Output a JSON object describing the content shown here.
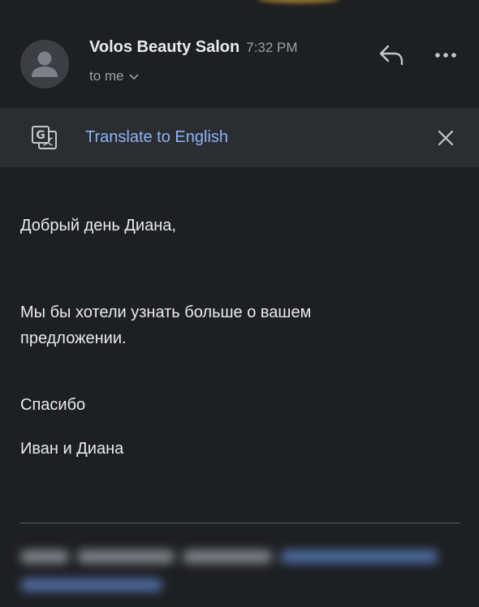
{
  "email": {
    "sender": "Volos Beauty Salon",
    "time": "7:32 PM",
    "recipient_line": "to me"
  },
  "icons": {
    "avatar": "person-avatar-icon",
    "reply": "reply-arrow-icon",
    "more": "more-horizontal-icon",
    "translate": "google-translate-icon",
    "close": "close-x-icon",
    "chevron": "chevron-down-icon"
  },
  "translate_bar": {
    "link_label": "Translate to English"
  },
  "body": {
    "greeting": "Добрый день Диана,",
    "paragraph": "Мы бы хотели узнать больше о вашем\nпредложении.",
    "thanks": "Спасибо",
    "signature": "Иван и Диана"
  },
  "colors": {
    "background": "#1e1f23",
    "translate_bar": "#2c2d31",
    "link_blue": "#8ab4f8",
    "muted_text": "#9aa0a6"
  }
}
